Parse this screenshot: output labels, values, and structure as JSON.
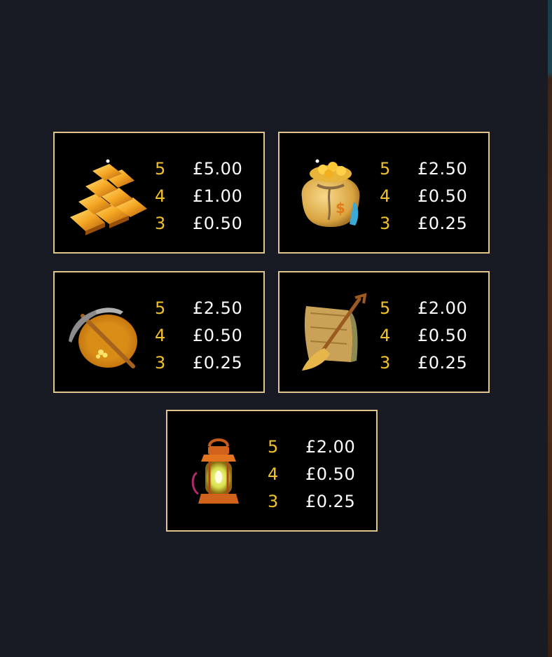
{
  "paytable": [
    {
      "symbol": "gold-bars",
      "icon": "gold-bars-icon",
      "pays": [
        {
          "count": "5",
          "amount": "£5.00"
        },
        {
          "count": "4",
          "amount": "£1.00"
        },
        {
          "count": "3",
          "amount": "£0.50"
        }
      ]
    },
    {
      "symbol": "money-bag",
      "icon": "money-bag-icon",
      "pays": [
        {
          "count": "5",
          "amount": "£2.50"
        },
        {
          "count": "4",
          "amount": "£0.50"
        },
        {
          "count": "3",
          "amount": "£0.25"
        }
      ]
    },
    {
      "symbol": "pickaxe-and-pan",
      "icon": "pickaxe-pan-icon",
      "pays": [
        {
          "count": "5",
          "amount": "£2.50"
        },
        {
          "count": "4",
          "amount": "£0.50"
        },
        {
          "count": "3",
          "amount": "£0.25"
        }
      ]
    },
    {
      "symbol": "map-and-shovel",
      "icon": "map-shovel-icon",
      "pays": [
        {
          "count": "5",
          "amount": "£2.00"
        },
        {
          "count": "4",
          "amount": "£0.50"
        },
        {
          "count": "3",
          "amount": "£0.25"
        }
      ]
    },
    {
      "symbol": "lantern",
      "icon": "lantern-icon",
      "pays": [
        {
          "count": "5",
          "amount": "£2.00"
        },
        {
          "count": "4",
          "amount": "£0.50"
        },
        {
          "count": "3",
          "amount": "£0.25"
        }
      ]
    }
  ],
  "colors": {
    "background": "#181a24",
    "card_border": "#e2c58c",
    "count_text": "#f2c12e",
    "amount_text": "#ffffff"
  }
}
